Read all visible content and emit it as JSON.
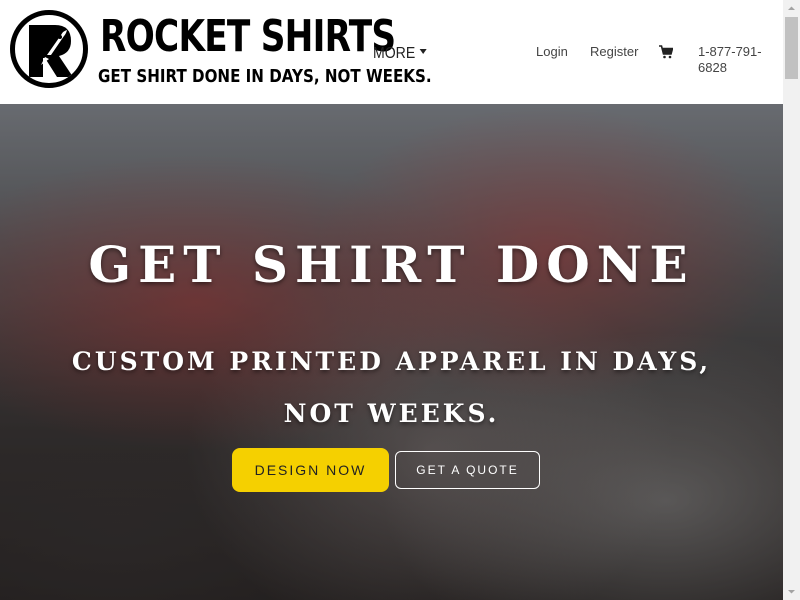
{
  "brand": {
    "name": "ROCKET SHIRTS",
    "tagline": "GET SHIRT DONE IN DAYS, NOT WEEKS.",
    "logo_icon": "rocket-r-logo-icon"
  },
  "nav": {
    "more_label": "MORE",
    "login_label": "Login",
    "register_label": "Register",
    "cart_icon": "cart-icon",
    "phone": "1-877-791-6828"
  },
  "hero": {
    "title": "GET SHIRT DONE",
    "subtitle_line1": "CUSTOM PRINTED APPAREL IN DAYS,",
    "subtitle_line2": "NOT WEEKS.",
    "design_button": "DESIGN NOW",
    "quote_button": "GET A QUOTE"
  },
  "colors": {
    "accent_yellow": "#f5d000",
    "text_dark": "#000000",
    "hero_text": "#ffffff"
  }
}
